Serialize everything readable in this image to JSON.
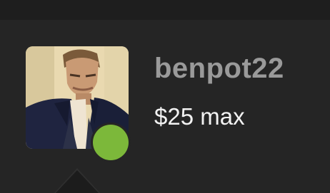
{
  "profile": {
    "username": "benpot22",
    "bid_limit": "$25 max",
    "status": "online",
    "colors": {
      "status_online": "#7cb83a",
      "username_text": "#9a9a9a",
      "limit_text": "#f2f2f2",
      "background": "#232323"
    }
  }
}
